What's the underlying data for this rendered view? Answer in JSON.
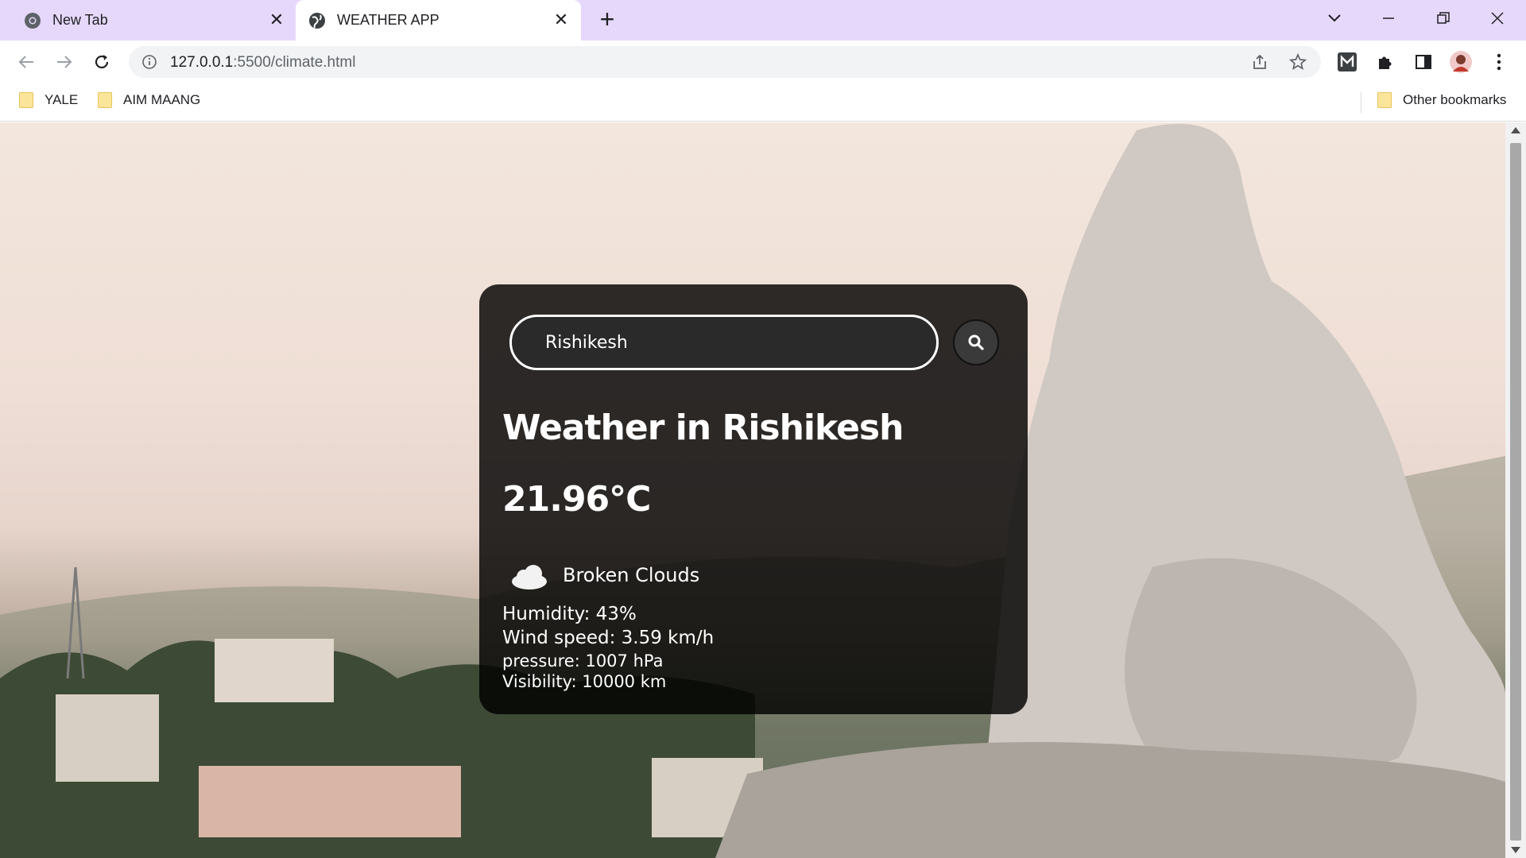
{
  "browser": {
    "tabs": [
      {
        "title": "New Tab",
        "icon": "chrome-icon"
      },
      {
        "title": "WEATHER APP",
        "icon": "globe-icon"
      }
    ],
    "url_host": "127.0.0.1",
    "url_path": ":5500/climate.html",
    "bookmarks": [
      {
        "label": "YALE"
      },
      {
        "label": "AIM MAANG"
      }
    ],
    "other_bookmarks": "Other bookmarks",
    "tabstrip_color": "#e6d8fb"
  },
  "weather": {
    "search_value": "Rishikesh",
    "heading": "Weather in Rishikesh",
    "temperature": "21.96°C",
    "condition": "Broken Clouds",
    "humidity": "Humidity: 43%",
    "wind": "Wind speed: 3.59 km/h",
    "pressure": "pressure: 1007 hPa",
    "visibility": "Visibility: 10000 km"
  }
}
